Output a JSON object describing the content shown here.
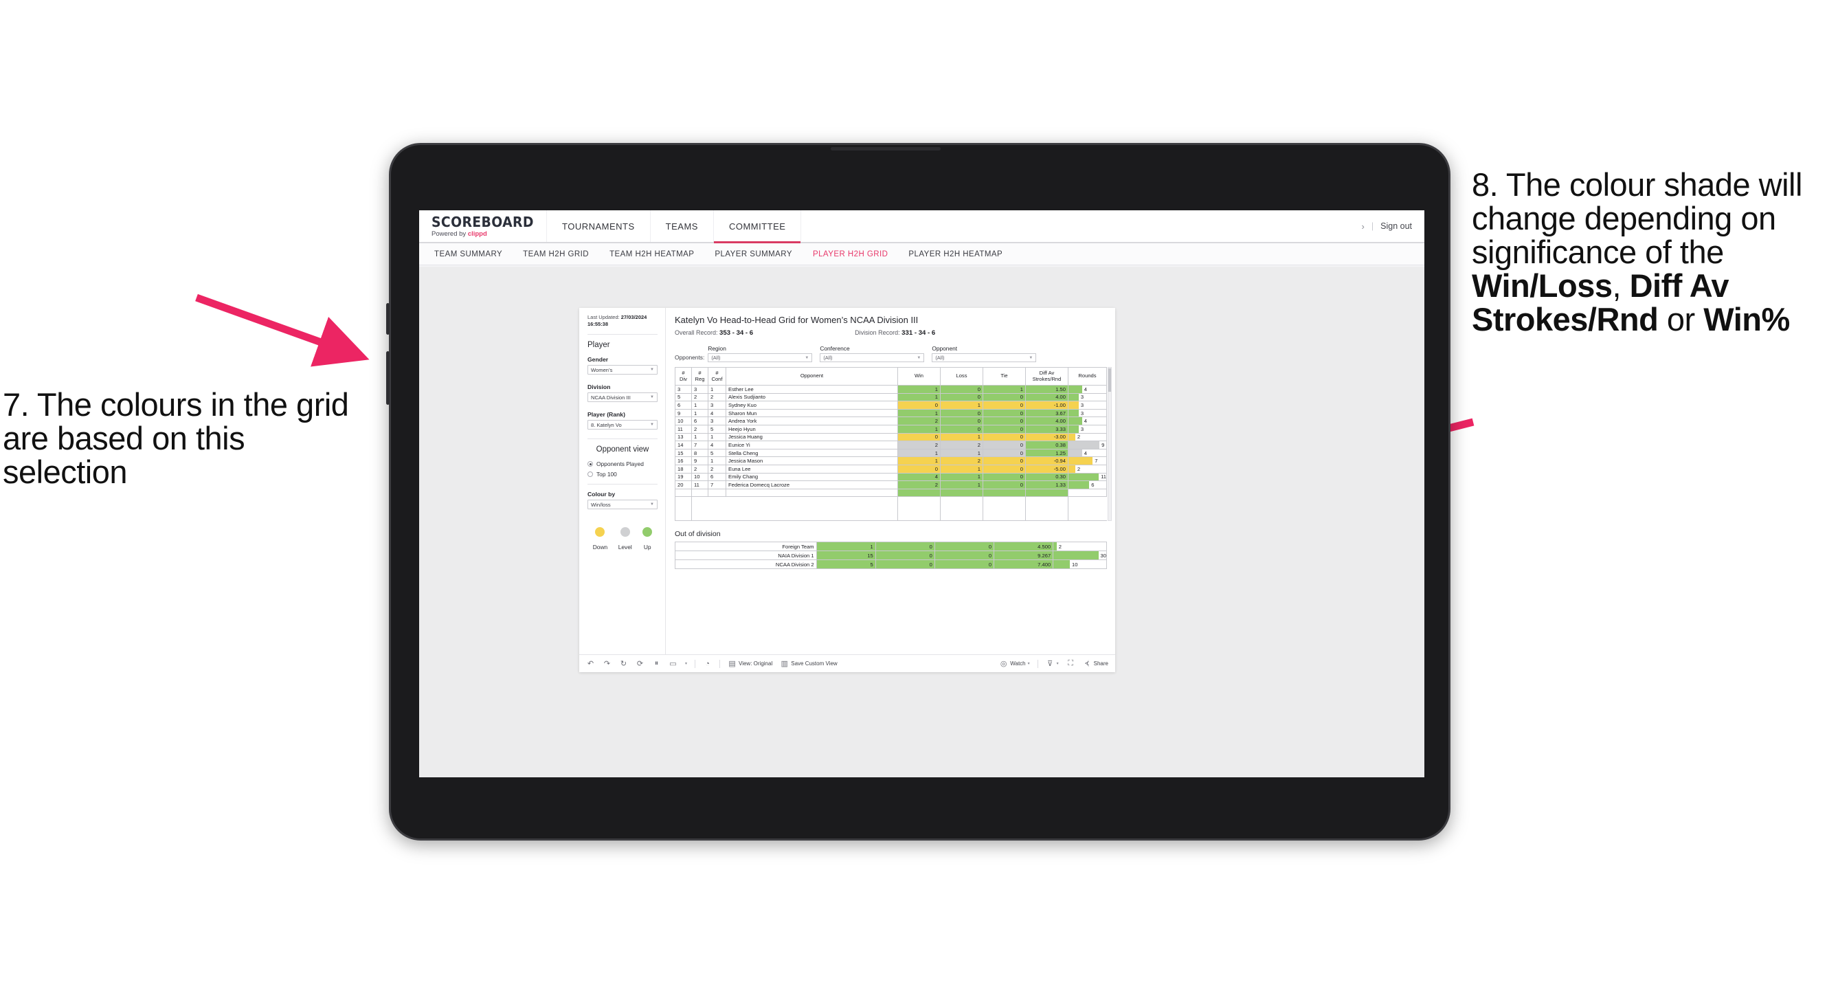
{
  "annotations": {
    "left": {
      "text": "7. The colours in the grid are based on this selection",
      "arrow_color": "#ec2563"
    },
    "right": {
      "line1": "8. The colour shade will change depending on ",
      "bold1": "Win/Loss",
      "mid1": ", ",
      "bold2": "Diff Av Strokes/Rnd",
      "mid2": " or ",
      "bold3": "Win%",
      "prefix_significance": "significance of the ",
      "arrow_color": "#ec2563"
    }
  },
  "app": {
    "logo": {
      "main": "SCOREBOARD",
      "powered_by": "Powered by",
      "brand": "clippd"
    },
    "topnav": [
      {
        "label": "TOURNAMENTS",
        "active": false
      },
      {
        "label": "TEAMS",
        "active": false
      },
      {
        "label": "COMMITTEE",
        "active": true
      }
    ],
    "header_right": {
      "chevron": "›",
      "pipe": "|",
      "signout": "Sign out"
    },
    "subnav": [
      {
        "label": "TEAM SUMMARY",
        "active": false
      },
      {
        "label": "TEAM H2H GRID",
        "active": false
      },
      {
        "label": "TEAM H2H HEATMAP",
        "active": false
      },
      {
        "label": "PLAYER SUMMARY",
        "active": false
      },
      {
        "label": "PLAYER H2H GRID",
        "active": true
      },
      {
        "label": "PLAYER H2H HEATMAP",
        "active": false
      }
    ]
  },
  "panel": {
    "last_updated_label": "Last Updated:",
    "last_updated_value": "27/03/2024 16:55:38",
    "player_heading": "Player",
    "gender_label": "Gender",
    "gender_value": "Women’s",
    "division_label": "Division",
    "division_value": "NCAA Division III",
    "player_rank_label": "Player (Rank)",
    "player_rank_value": "8. Katelyn Vo",
    "opponent_view_heading": "Opponent view",
    "opponent_view_options": [
      {
        "label": "Opponents Played",
        "selected": true
      },
      {
        "label": "Top 100",
        "selected": false
      }
    ],
    "colour_by_label": "Colour by",
    "colour_by_value": "Win/loss",
    "legend": [
      {
        "label": "Down",
        "color": "#f5d250"
      },
      {
        "label": "Level",
        "color": "#cfd0d2"
      },
      {
        "label": "Up",
        "color": "#92cc6c"
      }
    ]
  },
  "main": {
    "title": "Katelyn Vo Head-to-Head Grid for Women’s NCAA Division III",
    "overall_record_label": "Overall Record:",
    "overall_record_value": "353 -  34 - 6",
    "division_record_label": "Division Record:",
    "division_record_value": "331 -  34 - 6",
    "opponents_label": "Opponents:",
    "filters": [
      {
        "caption": "Region",
        "value": "(All)"
      },
      {
        "caption": "Conference",
        "value": "(All)"
      },
      {
        "caption": "Opponent",
        "value": "(All)"
      }
    ],
    "headers": {
      "div": "#\nDiv",
      "reg": "#\nReg",
      "conf": "#\nConf",
      "opponent": "Opponent",
      "win": "Win",
      "loss": "Loss",
      "tie": "Tie",
      "diff": "Diff Av\nStrokes/Rnd",
      "rounds": "Rounds"
    },
    "out_of_division_title": "Out of division"
  },
  "chart_data": {
    "type": "table",
    "title": "Katelyn Vo Head-to-Head Grid for Women’s NCAA Division III",
    "columns": [
      "# Div",
      "# Reg",
      "# Conf",
      "Opponent",
      "Win",
      "Loss",
      "Tie",
      "Diff Av Strokes/Rnd",
      "Rounds"
    ],
    "rows": [
      {
        "div": "3",
        "reg": "3",
        "conf": "1",
        "opponent": "Esther Lee",
        "win": "1",
        "loss": "0",
        "tie": "1",
        "diff": "1.50",
        "rounds": "4",
        "color": "g",
        "bar_pct": 36
      },
      {
        "div": "5",
        "reg": "2",
        "conf": "2",
        "opponent": "Alexis Sudjianto",
        "win": "1",
        "loss": "0",
        "tie": "0",
        "diff": "4.00",
        "rounds": "3",
        "color": "g",
        "bar_pct": 27
      },
      {
        "div": "6",
        "reg": "1",
        "conf": "3",
        "opponent": "Sydney Kuo",
        "win": "0",
        "loss": "1",
        "tie": "0",
        "diff": "-1.00",
        "rounds": "3",
        "color": "y",
        "bar_pct": 27
      },
      {
        "div": "9",
        "reg": "1",
        "conf": "4",
        "opponent": "Sharon Mun",
        "win": "1",
        "loss": "0",
        "tie": "0",
        "diff": "3.67",
        "rounds": "3",
        "color": "g",
        "bar_pct": 27
      },
      {
        "div": "10",
        "reg": "6",
        "conf": "3",
        "opponent": "Andrea York",
        "win": "2",
        "loss": "0",
        "tie": "0",
        "diff": "4.00",
        "rounds": "4",
        "color": "g",
        "bar_pct": 36
      },
      {
        "div": "11",
        "reg": "2",
        "conf": "5",
        "opponent": "Heejo Hyun",
        "win": "1",
        "loss": "0",
        "tie": "0",
        "diff": "3.33",
        "rounds": "3",
        "color": "g",
        "bar_pct": 27
      },
      {
        "div": "13",
        "reg": "1",
        "conf": "1",
        "opponent": "Jessica Huang",
        "win": "0",
        "loss": "1",
        "tie": "0",
        "diff": "-3.00",
        "rounds": "2",
        "color": "y",
        "bar_pct": 18
      },
      {
        "div": "14",
        "reg": "7",
        "conf": "4",
        "opponent": "Eunice Yi",
        "win": "2",
        "loss": "2",
        "tie": "0",
        "diff": "0.38",
        "rounds": "9",
        "color": "gr",
        "diff_color": "g",
        "bar_pct": 82
      },
      {
        "div": "15",
        "reg": "8",
        "conf": "5",
        "opponent": "Stella Cheng",
        "win": "1",
        "loss": "1",
        "tie": "0",
        "diff": "1.25",
        "rounds": "4",
        "color": "gr",
        "diff_color": "g",
        "bar_pct": 36
      },
      {
        "div": "16",
        "reg": "9",
        "conf": "1",
        "opponent": "Jessica Mason",
        "win": "1",
        "loss": "2",
        "tie": "0",
        "diff": "-0.94",
        "rounds": "7",
        "color": "y",
        "bar_pct": 64
      },
      {
        "div": "18",
        "reg": "2",
        "conf": "2",
        "opponent": "Euna Lee",
        "win": "0",
        "loss": "1",
        "tie": "0",
        "diff": "-5.00",
        "rounds": "2",
        "color": "y",
        "bar_pct": 18
      },
      {
        "div": "19",
        "reg": "10",
        "conf": "6",
        "opponent": "Emily Chang",
        "win": "4",
        "loss": "1",
        "tie": "0",
        "diff": "0.30",
        "rounds": "11",
        "color": "g",
        "bar_pct": 100
      },
      {
        "div": "20",
        "reg": "11",
        "conf": "7",
        "opponent": "Federica Domecq Lacroze",
        "win": "2",
        "loss": "1",
        "tie": "0",
        "diff": "1.33",
        "rounds": "6",
        "color": "g",
        "bar_pct": 55
      }
    ],
    "out_of_division": [
      {
        "name": "Foreign Team",
        "win": "1",
        "loss": "0",
        "tie": "0",
        "diff": "4.500",
        "rounds": "2",
        "color": "g",
        "bar_pct": 6
      },
      {
        "name": "NAIA Division 1",
        "win": "15",
        "loss": "0",
        "tie": "0",
        "diff": "9.267",
        "rounds": "30",
        "color": "g",
        "bar_pct": 93
      },
      {
        "name": "NCAA Division 2",
        "win": "5",
        "loss": "0",
        "tie": "0",
        "diff": "7.400",
        "rounds": "10",
        "color": "g",
        "bar_pct": 31
      }
    ],
    "colors": {
      "up": "#92cc6c",
      "down": "#f5d250",
      "level": "#cfd0d2"
    }
  },
  "toolbar": {
    "view_label": "View: Original",
    "save_label": "Save Custom View",
    "watch_label": "Watch",
    "share_label": "Share",
    "icons": [
      "undo-icon",
      "redo-icon",
      "revert-icon",
      "refresh-icon",
      "pause-icon",
      "shape-icon",
      "caret-icon",
      "help-icon"
    ]
  }
}
